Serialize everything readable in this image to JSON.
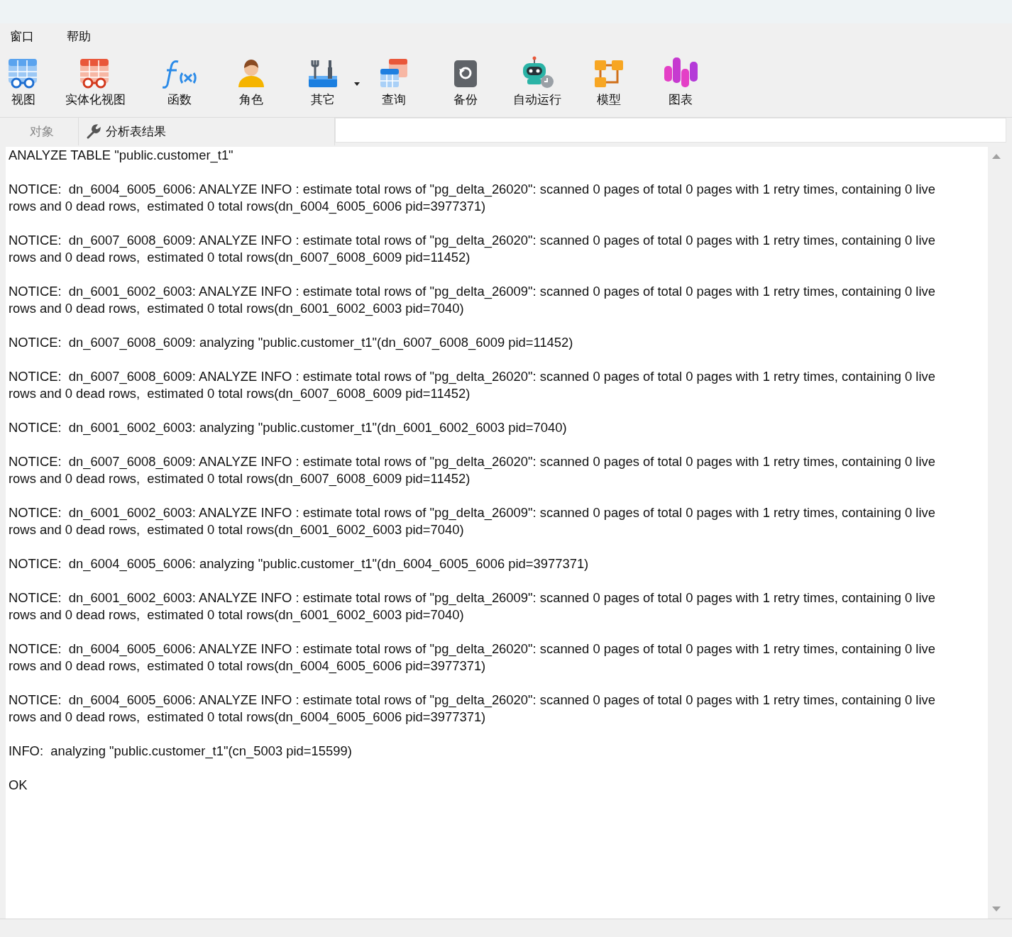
{
  "menu": [
    "窗口",
    "帮助"
  ],
  "toolbar": [
    {
      "label": "视图",
      "kind": "view"
    },
    {
      "label": "实体化视图",
      "kind": "matview"
    },
    {
      "label": "函数",
      "kind": "function"
    },
    {
      "label": "角色",
      "kind": "role"
    },
    {
      "label": "其它",
      "kind": "other",
      "dropdown": true
    },
    {
      "label": "查询",
      "kind": "query"
    },
    {
      "label": "备份",
      "kind": "backup"
    },
    {
      "label": "自动运行",
      "kind": "automation"
    },
    {
      "label": "模型",
      "kind": "model"
    },
    {
      "label": "图表",
      "kind": "chart"
    }
  ],
  "tabs": [
    {
      "label": "对象",
      "selected": false
    },
    {
      "label": "分析表结果",
      "selected": true
    }
  ],
  "output": [
    [
      "ANALYZE TABLE \"public.customer_t1\""
    ],
    [
      "NOTICE:  dn_6004_6005_6006: ANALYZE INFO : estimate total rows of \"pg_delta_26020\": scanned 0 pages of total 0 pages with 1 retry times, containing 0 live",
      "rows and 0 dead rows,  estimated 0 total rows(dn_6004_6005_6006 pid=3977371)"
    ],
    [
      "NOTICE:  dn_6007_6008_6009: ANALYZE INFO : estimate total rows of \"pg_delta_26020\": scanned 0 pages of total 0 pages with 1 retry times, containing 0 live",
      "rows and 0 dead rows,  estimated 0 total rows(dn_6007_6008_6009 pid=11452)"
    ],
    [
      "NOTICE:  dn_6001_6002_6003: ANALYZE INFO : estimate total rows of \"pg_delta_26009\": scanned 0 pages of total 0 pages with 1 retry times, containing 0 live",
      "rows and 0 dead rows,  estimated 0 total rows(dn_6001_6002_6003 pid=7040)"
    ],
    [
      "NOTICE:  dn_6007_6008_6009: analyzing \"public.customer_t1\"(dn_6007_6008_6009 pid=11452)"
    ],
    [
      "NOTICE:  dn_6007_6008_6009: ANALYZE INFO : estimate total rows of \"pg_delta_26020\": scanned 0 pages of total 0 pages with 1 retry times, containing 0 live",
      "rows and 0 dead rows,  estimated 0 total rows(dn_6007_6008_6009 pid=11452)"
    ],
    [
      "NOTICE:  dn_6001_6002_6003: analyzing \"public.customer_t1\"(dn_6001_6002_6003 pid=7040)"
    ],
    [
      "NOTICE:  dn_6007_6008_6009: ANALYZE INFO : estimate total rows of \"pg_delta_26020\": scanned 0 pages of total 0 pages with 1 retry times, containing 0 live",
      "rows and 0 dead rows,  estimated 0 total rows(dn_6007_6008_6009 pid=11452)"
    ],
    [
      "NOTICE:  dn_6001_6002_6003: ANALYZE INFO : estimate total rows of \"pg_delta_26009\": scanned 0 pages of total 0 pages with 1 retry times, containing 0 live",
      "rows and 0 dead rows,  estimated 0 total rows(dn_6001_6002_6003 pid=7040)"
    ],
    [
      "NOTICE:  dn_6004_6005_6006: analyzing \"public.customer_t1\"(dn_6004_6005_6006 pid=3977371)"
    ],
    [
      "NOTICE:  dn_6001_6002_6003: ANALYZE INFO : estimate total rows of \"pg_delta_26009\": scanned 0 pages of total 0 pages with 1 retry times, containing 0 live",
      "rows and 0 dead rows,  estimated 0 total rows(dn_6001_6002_6003 pid=7040)"
    ],
    [
      "NOTICE:  dn_6004_6005_6006: ANALYZE INFO : estimate total rows of \"pg_delta_26020\": scanned 0 pages of total 0 pages with 1 retry times, containing 0 live",
      "rows and 0 dead rows,  estimated 0 total rows(dn_6004_6005_6006 pid=3977371)"
    ],
    [
      "NOTICE:  dn_6004_6005_6006: ANALYZE INFO : estimate total rows of \"pg_delta_26020\": scanned 0 pages of total 0 pages with 1 retry times, containing 0 live",
      "rows and 0 dead rows,  estimated 0 total rows(dn_6004_6005_6006 pid=3977371)"
    ],
    [
      "INFO:  analyzing \"public.customer_t1\"(cn_5003 pid=15599)"
    ],
    [
      "OK"
    ]
  ]
}
